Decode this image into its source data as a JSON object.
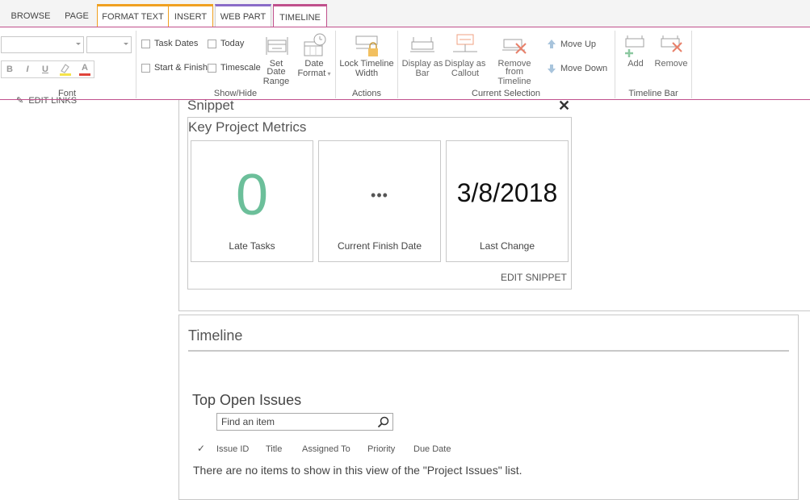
{
  "tabs": [
    {
      "label": "BROWSE"
    },
    {
      "label": "PAGE"
    },
    {
      "label": "FORMAT TEXT"
    },
    {
      "label": "INSERT"
    },
    {
      "label": "WEB PART"
    },
    {
      "label": "TIMELINE"
    }
  ],
  "ribbon": {
    "font": {
      "group_label": "Font",
      "bold": "B",
      "italic": "I",
      "underline": "U",
      "font_color": "A"
    },
    "show_hide": {
      "group_label": "Show/Hide",
      "task_dates": "Task Dates",
      "today": "Today",
      "start_finish": "Start & Finish",
      "timescale": "Timescale",
      "set_date_range": [
        "Set Date",
        "Range"
      ],
      "date_format": [
        "Date",
        "Format"
      ]
    },
    "actions": {
      "group_label": "Actions",
      "lock_timeline_width": [
        "Lock Timeline",
        "Width"
      ]
    },
    "current_selection": {
      "group_label": "Current Selection",
      "display_as_bar": [
        "Display as",
        "Bar"
      ],
      "display_as_callout": [
        "Display as",
        "Callout"
      ],
      "remove_from_timeline": [
        "Remove from",
        "Timeline"
      ],
      "move_up": "Move Up",
      "move_down": "Move Down"
    },
    "timeline_bar": {
      "group_label": "Timeline Bar",
      "add": "Add",
      "remove": "Remove"
    }
  },
  "left_nav": {
    "edit_links": "EDIT LINKS"
  },
  "snippet": {
    "title": "Snippet",
    "close": "✕",
    "metrics_title": "Key Project Metrics",
    "tiles": [
      {
        "value": "0",
        "caption": "Late Tasks",
        "color": "#6cbf9a"
      },
      {
        "value": "•••",
        "caption": "Current Finish Date",
        "color": "#555555"
      },
      {
        "value": "3/8/2018",
        "caption": "Last Change",
        "color": "#111111"
      }
    ],
    "edit_snippet": "EDIT SNIPPET"
  },
  "timeline": {
    "title": "Timeline"
  },
  "issues": {
    "title": "Top Open Issues",
    "search_placeholder": "Find an item",
    "check": "✓",
    "columns": [
      "Issue ID",
      "Title",
      "Assigned To",
      "Priority",
      "Due Date"
    ],
    "empty_message": "There are no items to show in this view of the \"Project Issues\" list."
  },
  "colors": {
    "timeline_accent": "#c0508c",
    "format_text_accent": "#f0a020",
    "web_part_accent": "#8a6cc8",
    "late_tasks_green": "#6cbf9a"
  }
}
